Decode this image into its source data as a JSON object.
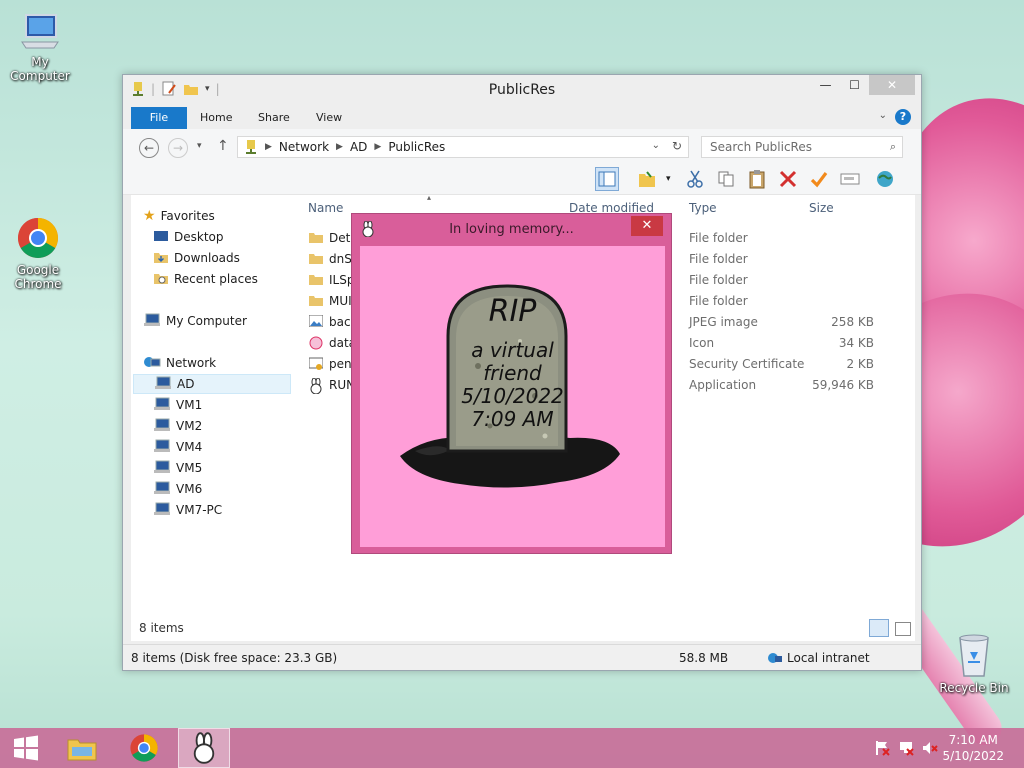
{
  "desktop": {
    "icons": [
      {
        "label": "My Computer",
        "icon": "computer-icon"
      },
      {
        "label": "Google Chrome",
        "icon": "chrome-icon"
      },
      {
        "label": "Recycle Bin",
        "icon": "recycle-bin-icon"
      }
    ]
  },
  "explorer": {
    "title": "PublicRes",
    "ribbon_tabs": [
      "File",
      "Home",
      "Share",
      "View"
    ],
    "breadcrumb": [
      "Network",
      "AD",
      "PublicRes"
    ],
    "search_placeholder": "Search PublicRes",
    "nav": {
      "favorites": "Favorites",
      "favorites_items": [
        "Desktop",
        "Downloads",
        "Recent places"
      ],
      "my_computer": "My Computer",
      "network": "Network",
      "network_items": [
        "AD",
        "VM1",
        "VM2",
        "VM4",
        "VM5",
        "VM6",
        "VM7-PC"
      ],
      "selected": "AD"
    },
    "columns": [
      "Name",
      "Date modified",
      "Type",
      "Size"
    ],
    "files": [
      {
        "name": "Dete",
        "type": "File folder",
        "size": "",
        "icon": "folder-icon"
      },
      {
        "name": "dnSp",
        "type": "File folder",
        "size": "",
        "icon": "folder-icon"
      },
      {
        "name": "ILSpy",
        "type": "File folder",
        "size": "",
        "icon": "folder-icon"
      },
      {
        "name": "MUI",
        "type": "File folder",
        "size": "",
        "icon": "folder-icon"
      },
      {
        "name": "back",
        "type": "JPEG image",
        "size": "258 KB",
        "icon": "image-file-icon"
      },
      {
        "name": "data",
        "type": "Icon",
        "size": "34 KB",
        "icon": "icon-file-icon"
      },
      {
        "name": "peni",
        "type": "Security Certificate",
        "size": "2 KB",
        "icon": "certificate-icon"
      },
      {
        "name": "RUN",
        "type": "Application",
        "size": "59,946 KB",
        "icon": "application-icon"
      }
    ],
    "item_count": "8 items",
    "status_left": "8 items (Disk free space: 23.3 GB)",
    "status_size": "58.8 MB",
    "status_zone": "Local intranet"
  },
  "memory_window": {
    "title": "In loving memory...",
    "close_glyph": "✕",
    "tombstone_lines": [
      "RIP",
      "a virtual",
      "friend",
      "5/10/2022",
      "7:09 AM"
    ]
  },
  "taskbar": {
    "time": "7:10 AM",
    "date": "5/10/2022"
  },
  "colors": {
    "accent": "#1979ca",
    "prank_bg": "#ff9ed8",
    "prank_frame": "#d95e9a",
    "close_red": "#c93943"
  }
}
